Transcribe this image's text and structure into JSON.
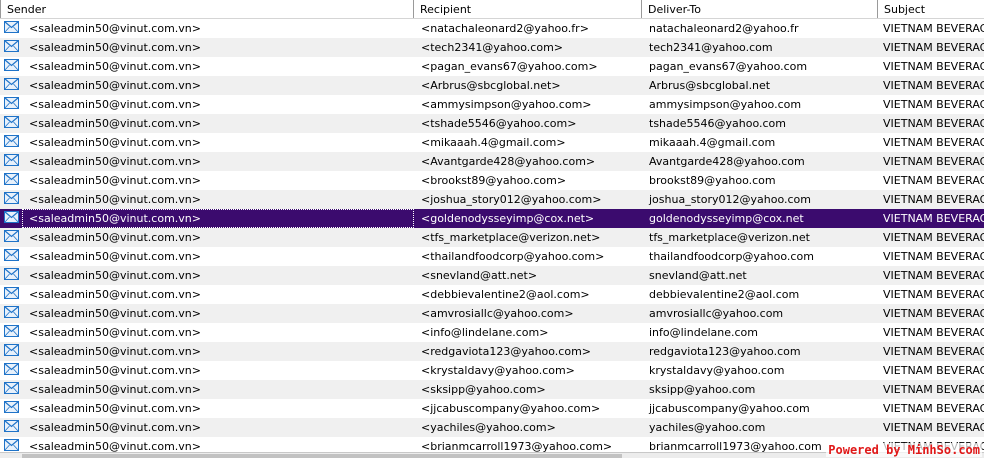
{
  "columns": {
    "sender": "Sender",
    "recipient": "Recipient",
    "deliver_to": "Deliver-To",
    "subject": "Subject"
  },
  "row_icon": "envelope-icon",
  "colors": {
    "selected_row": "#3b0b6e",
    "alt_row": "#f0f0f0",
    "envelope": "#1f73c8",
    "watermark": "#e01818"
  },
  "selected_index": 10,
  "rows": [
    {
      "sender": "<saleadmin50@vinut.com.vn>",
      "recipient": "<natachaleonard2@yahoo.fr>",
      "deliver_to": "natachaleonard2@yahoo.fr",
      "subject": "VIETNAM BEVERAG"
    },
    {
      "sender": "<saleadmin50@vinut.com.vn>",
      "recipient": "<tech2341@yahoo.com>",
      "deliver_to": "tech2341@yahoo.com",
      "subject": "VIETNAM BEVERAG"
    },
    {
      "sender": "<saleadmin50@vinut.com.vn>",
      "recipient": "<pagan_evans67@yahoo.com>",
      "deliver_to": "pagan_evans67@yahoo.com",
      "subject": "VIETNAM BEVERAG"
    },
    {
      "sender": "<saleadmin50@vinut.com.vn>",
      "recipient": "<Arbrus@sbcglobal.net>",
      "deliver_to": "Arbrus@sbcglobal.net",
      "subject": "VIETNAM BEVERAG"
    },
    {
      "sender": "<saleadmin50@vinut.com.vn>",
      "recipient": "<ammysimpson@yahoo.com>",
      "deliver_to": "ammysimpson@yahoo.com",
      "subject": "VIETNAM BEVERAG"
    },
    {
      "sender": "<saleadmin50@vinut.com.vn>",
      "recipient": "<tshade5546@yahoo.com>",
      "deliver_to": "tshade5546@yahoo.com",
      "subject": "VIETNAM BEVERAG"
    },
    {
      "sender": "<saleadmin50@vinut.com.vn>",
      "recipient": "<mikaaah.4@gmail.com>",
      "deliver_to": "mikaaah.4@gmail.com",
      "subject": "VIETNAM BEVERAG"
    },
    {
      "sender": "<saleadmin50@vinut.com.vn>",
      "recipient": "<Avantgarde428@yahoo.com>",
      "deliver_to": "Avantgarde428@yahoo.com",
      "subject": "VIETNAM BEVERAG"
    },
    {
      "sender": "<saleadmin50@vinut.com.vn>",
      "recipient": "<brookst89@yahoo.com>",
      "deliver_to": "brookst89@yahoo.com",
      "subject": "VIETNAM BEVERAG"
    },
    {
      "sender": "<saleadmin50@vinut.com.vn>",
      "recipient": "<joshua_story012@yahoo.com>",
      "deliver_to": "joshua_story012@yahoo.com",
      "subject": "VIETNAM BEVERAG"
    },
    {
      "sender": "<saleadmin50@vinut.com.vn>",
      "recipient": "<goldenodysseyimp@cox.net>",
      "deliver_to": "goldenodysseyimp@cox.net",
      "subject": "VIETNAM BEVERAG"
    },
    {
      "sender": "<saleadmin50@vinut.com.vn>",
      "recipient": "<tfs_marketplace@verizon.net>",
      "deliver_to": "tfs_marketplace@verizon.net",
      "subject": "VIETNAM BEVERAG"
    },
    {
      "sender": "<saleadmin50@vinut.com.vn>",
      "recipient": "<thailandfoodcorp@yahoo.com>",
      "deliver_to": "thailandfoodcorp@yahoo.com",
      "subject": "VIETNAM BEVERAG"
    },
    {
      "sender": "<saleadmin50@vinut.com.vn>",
      "recipient": "<snevland@att.net>",
      "deliver_to": "snevland@att.net",
      "subject": "VIETNAM BEVERAG"
    },
    {
      "sender": "<saleadmin50@vinut.com.vn>",
      "recipient": "<debbievalentine2@aol.com>",
      "deliver_to": "debbievalentine2@aol.com",
      "subject": "VIETNAM BEVERAG"
    },
    {
      "sender": "<saleadmin50@vinut.com.vn>",
      "recipient": "<amvrosiallc@yahoo.com>",
      "deliver_to": "amvrosiallc@yahoo.com",
      "subject": "VIETNAM BEVERAG"
    },
    {
      "sender": "<saleadmin50@vinut.com.vn>",
      "recipient": "<info@lindelane.com>",
      "deliver_to": "info@lindelane.com",
      "subject": "VIETNAM BEVERAG"
    },
    {
      "sender": "<saleadmin50@vinut.com.vn>",
      "recipient": "<redgaviota123@yahoo.com>",
      "deliver_to": "redgaviota123@yahoo.com",
      "subject": "VIETNAM BEVERAG"
    },
    {
      "sender": "<saleadmin50@vinut.com.vn>",
      "recipient": "<krystaldavy@yahoo.com>",
      "deliver_to": "krystaldavy@yahoo.com",
      "subject": "VIETNAM BEVERAG"
    },
    {
      "sender": "<saleadmin50@vinut.com.vn>",
      "recipient": "<sksipp@yahoo.com>",
      "deliver_to": "sksipp@yahoo.com",
      "subject": "VIETNAM BEVERAG"
    },
    {
      "sender": "<saleadmin50@vinut.com.vn>",
      "recipient": "<jjcabuscompany@yahoo.com>",
      "deliver_to": "jjcabuscompany@yahoo.com",
      "subject": "VIETNAM BEVERAG"
    },
    {
      "sender": "<saleadmin50@vinut.com.vn>",
      "recipient": "<yachiles@yahoo.com>",
      "deliver_to": "yachiles@yahoo.com",
      "subject": "VIETNAM BEVERAG"
    },
    {
      "sender": "<saleadmin50@vinut.com.vn>",
      "recipient": "<brianmcarroll1973@yahoo.com>",
      "deliver_to": "brianmcarroll1973@yahoo.com",
      "subject": "VIETNAM BEVERAG"
    }
  ],
  "watermark": "Powered by MinhSo.com"
}
